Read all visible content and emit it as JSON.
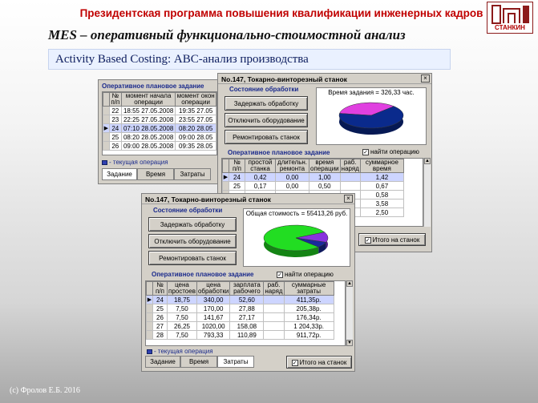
{
  "slide": {
    "header": "Президентская программа повышения квалификации инженерных кадров",
    "subtitle": "MES – оперативный функционально-стоимостной анализ",
    "abc": "Activity Based Costing:  АВС-анализ производства",
    "footer": "(с) Фролов  Е.Б. 2016",
    "logo_text": "СТАНКИН"
  },
  "back_window": {
    "group": "Оперативное плановое задание",
    "columns": [
      "№ п/п",
      "момент начала операции",
      "момент окон операции"
    ],
    "rows": [
      [
        "22",
        "18:55 27.05.2008",
        "19:35 27.05"
      ],
      [
        "23",
        "22:25 27.05.2008",
        "23:55 27.05"
      ],
      [
        "24",
        "07:10 28.05.2008",
        "08:20 28.05"
      ],
      [
        "25",
        "08:20 28.05.2008",
        "09:00 28.05"
      ],
      [
        "26",
        "09:00 28.05.2008",
        "09:35 28.05"
      ]
    ],
    "selected_row": 2,
    "legend": "- текущая операция",
    "tabs": [
      "Задание",
      "Время",
      "Затраты"
    ],
    "active_tab": 0
  },
  "window_time": {
    "title": "No.147,  Токарно-винторезный станок",
    "close": "×",
    "state_label": "Состояние обработки",
    "buttons": [
      "Задержать обработку",
      "Отключить оборудование",
      "Ремонтировать станок"
    ],
    "summary": "Время задания = 326,33 час.",
    "pie": [
      {
        "label": "slice-1",
        "value": 35,
        "color": "#e040e0"
      },
      {
        "label": "slice-2",
        "value": 65,
        "color": "#0a2a8c"
      }
    ],
    "plan_label": "Оперативное плановое задание",
    "find_op": "найти операцию",
    "columns": [
      "№ п/п",
      "простой станка",
      "длительн. ремонта",
      "время операции",
      "раб. наряд",
      "суммарное время"
    ],
    "rows": [
      [
        "24",
        "0,42",
        "0,00",
        "1,00",
        "",
        "1,42"
      ],
      [
        "25",
        "0,17",
        "0,00",
        "0,50",
        "",
        "0,67"
      ],
      [
        "",
        "",
        "",
        "",
        "",
        "0,58"
      ],
      [
        "",
        "",
        "",
        "",
        "",
        "3,58"
      ],
      [
        "",
        "",
        "",
        "",
        "",
        "2,50"
      ]
    ],
    "selected_row": 0,
    "total_button": "Итого на станок"
  },
  "window_cost": {
    "title": "No.147,  Токарно-винторезный станок",
    "close": "×",
    "state_label": "Состояние обработки",
    "buttons": [
      "Задержать обработку",
      "Отключить оборудование",
      "Ремонтировать станок"
    ],
    "summary": "Общая стоимость = 55413,26 руб.",
    "pie": [
      {
        "label": "slice-1",
        "value": 80,
        "color": "#22dd22"
      },
      {
        "label": "slice-2",
        "value": 13,
        "color": "#8833dd"
      },
      {
        "label": "slice-3",
        "value": 7,
        "color": "#1a2a9c"
      }
    ],
    "plan_label": "Оперативное плановое задание",
    "find_op": "найти операцию",
    "columns": [
      "№ п/п",
      "цена простоев",
      "цена обработки",
      "зарплата рабочего",
      "раб. наряд",
      "суммарные затраты"
    ],
    "rows": [
      [
        "24",
        "18,75",
        "340,00",
        "52,60",
        "",
        "411,35р."
      ],
      [
        "25",
        "7,50",
        "170,00",
        "27,88",
        "",
        "205,38р."
      ],
      [
        "26",
        "7,50",
        "141,67",
        "27,17",
        "",
        "176,34р."
      ],
      [
        "27",
        "26,25",
        "1020,00",
        "158,08",
        "",
        "1 204,33р."
      ],
      [
        "28",
        "7,50",
        "793,33",
        "110,89",
        "",
        "911,72р."
      ]
    ],
    "selected_row": 0,
    "legend": "- текущая операция",
    "tabs": [
      "Задание",
      "Время",
      "Затраты"
    ],
    "active_tab": 2,
    "total_button": "Итого на станок"
  }
}
